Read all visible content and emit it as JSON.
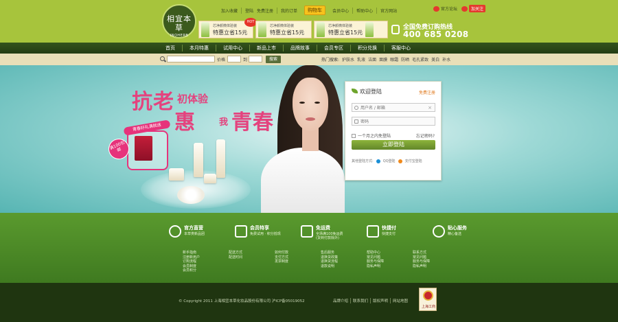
{
  "header": {
    "logo_text": "相宜本草",
    "logo_subtext": "INOHERB",
    "top_links": [
      "加入收藏",
      "登陆",
      "免费注册",
      "我的订单",
      "购物车",
      "会员中心",
      "帮助中心",
      "官方网站"
    ],
    "weibo": {
      "label": "官方论坛",
      "follow": "加关注"
    },
    "promos": [
      {
        "line1": "芯净颜微体验装",
        "line2": "特惠立省15元",
        "hot": "HOT"
      },
      {
        "line1": "芯净颜微体验装",
        "line2": "特惠立省15元"
      },
      {
        "line1": "芯净颜微体验装",
        "line2": "特惠立省15元"
      }
    ],
    "hotline_label": "全国免费订购热线",
    "hotline_number": "400 685 0208"
  },
  "main_nav": [
    "首页",
    "本月特惠",
    "试用中心",
    "新品上市",
    "品牌故事",
    "会员专区",
    "积分兑换",
    "客服中心"
  ],
  "search": {
    "price_label": "价格",
    "to_label": "到",
    "button": "搜索",
    "hot_label": "热门搜索:",
    "hot_terms": [
      "护肤水",
      "乳液",
      "洁面",
      "面膜",
      "眼霜",
      "防晒",
      "毛孔紧致",
      "美白",
      "补水"
    ]
  },
  "banner": {
    "headline_big1": "抗老",
    "headline_small1": "初体验",
    "headline_big2": "惠",
    "headline_small2": "我",
    "headline_big3": "青春",
    "seal_text": "满100包邮",
    "gift_text": "青春好礼满就送"
  },
  "login": {
    "title": "欢迎登陆",
    "register_link": "免费注册",
    "username_placeholder": "用户名 / 邮箱",
    "password_placeholder": "密码",
    "remember": "一个月之内免登陆",
    "forgot": "忘记密码?",
    "submit": "立即登陆",
    "other_label": "其他登陆方式:",
    "qq": "QQ登陆",
    "alipay": "支付宝登陆"
  },
  "features": [
    {
      "title": "官方直营",
      "desc": "本草类新品团"
    },
    {
      "title": "会员特享",
      "desc": "免费试用 · 积分抵现"
    },
    {
      "title": "免运费",
      "desc": "全场满100免运费\n(货到付款除外)"
    },
    {
      "title": "快捷付",
      "desc": "快捷支付"
    },
    {
      "title": "贴心服务",
      "desc": "精心备选"
    }
  ],
  "link_columns": [
    [
      "新手指南",
      "注册新用户",
      "订购流程",
      "会员制度",
      "会员积分"
    ],
    [
      "配送方式",
      "配送时间"
    ],
    [
      "如何付款",
      "支付方式",
      "发票制度"
    ],
    [
      "售后服务",
      "退换货政策",
      "退换货流程",
      "退款说明"
    ],
    [
      "帮助中心",
      "常见问题",
      "服务与保障",
      "隐私声明"
    ],
    [
      "联系方式",
      "常见问题",
      "服务与保障",
      "隐私声明"
    ]
  ],
  "footer": {
    "copyright": "© Copyright 2011 上海相宜本草化妆品股份有限公司 沪ICP备05019052",
    "links": [
      "品牌介绍",
      "联系我们",
      "版权声明",
      "网站地图"
    ],
    "badge_text": "上海工商"
  }
}
